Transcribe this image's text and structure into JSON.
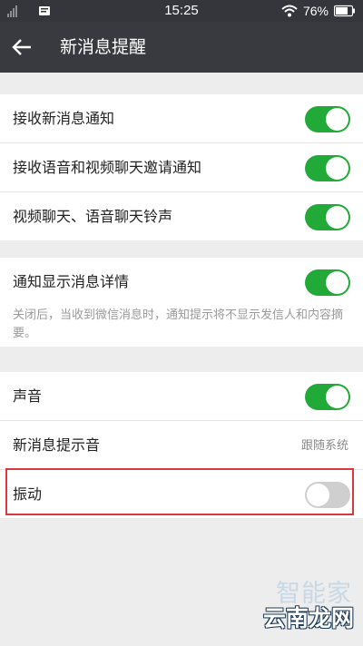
{
  "statusbar": {
    "time": "15:25",
    "battery": "76%"
  },
  "header": {
    "title": "新消息提醒"
  },
  "group1": {
    "items": [
      {
        "label": "接收新消息通知",
        "on": true
      },
      {
        "label": "接收语音和视频聊天邀请通知",
        "on": true
      },
      {
        "label": "视频聊天、语音聊天铃声",
        "on": true
      }
    ]
  },
  "group2": {
    "items": [
      {
        "label": "通知显示消息详情",
        "on": true
      }
    ],
    "description": "关闭后，当收到微信消息时，通知提示将不显示发信人和内容摘要。"
  },
  "group3": {
    "items": [
      {
        "label": "声音",
        "on": true
      },
      {
        "label": "新消息提示音",
        "value": "跟随系统"
      },
      {
        "label": "振动",
        "on": false
      }
    ]
  },
  "watermark": {
    "top": "智能家",
    "bottom": "云南龙网"
  },
  "colors": {
    "accent_green": "#22aa38",
    "header_bg": "#393a3f",
    "highlight_red": "#d9393b"
  }
}
